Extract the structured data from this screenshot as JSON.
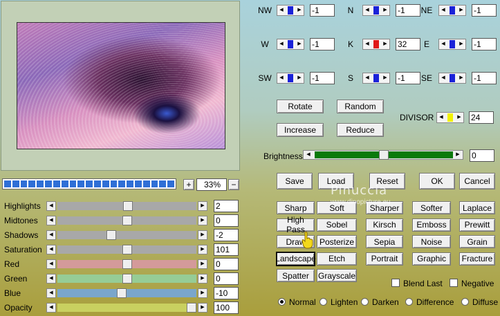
{
  "zoom": {
    "plus": "+",
    "value": "33%",
    "minus": "−"
  },
  "progress_segments": 21,
  "grid": [
    {
      "dir": "NW",
      "value": "-1",
      "color": "#1a22d8"
    },
    {
      "dir": "N",
      "value": "-1",
      "color": "#1a22d8"
    },
    {
      "dir": "NE",
      "value": "-1",
      "color": "#1a22d8"
    },
    {
      "dir": "W",
      "value": "-1",
      "color": "#1a22d8"
    },
    {
      "dir": "K",
      "value": "32",
      "color": "#e01818"
    },
    {
      "dir": "E",
      "value": "-1",
      "color": "#1a22d8"
    },
    {
      "dir": "SW",
      "value": "-1",
      "color": "#1a22d8"
    },
    {
      "dir": "S",
      "value": "-1",
      "color": "#1a22d8"
    },
    {
      "dir": "SE",
      "value": "-1",
      "color": "#1a22d8"
    }
  ],
  "action_buttons": {
    "rotate": "Rotate",
    "random": "Random",
    "increase": "Increase",
    "reduce": "Reduce"
  },
  "divisor": {
    "label": "DIVISOR",
    "value": "24",
    "color": "#f2f200"
  },
  "brightness": {
    "label": "Brightness",
    "value": "0",
    "level": 0.5,
    "color": "#0a7a0a"
  },
  "main_buttons": {
    "save": "Save",
    "load": "Load",
    "reset": "Reset",
    "ok": "OK",
    "cancel": "Cancel"
  },
  "watermark": {
    "title": "Pinuccia",
    "site": "www.dinopicture.eu"
  },
  "filters": [
    [
      "Sharp",
      "Soft",
      "Sharper",
      "Softer",
      "Laplace"
    ],
    [
      "High Pass",
      "Sobel",
      "Kirsch",
      "Emboss",
      "Prewitt"
    ],
    [
      "Draw",
      "Posterize",
      "Sepia",
      "Noise",
      "Grain"
    ],
    [
      "Landscape",
      "Etch",
      "Portrait",
      "Graphic",
      "Fracture"
    ],
    [
      "Spatter",
      "Grayscale"
    ]
  ],
  "selected_filter": "Landscape",
  "checkboxes": {
    "blend_last": "Blend Last",
    "negative": "Negative"
  },
  "blend_modes": [
    "Normal",
    "Lighten",
    "Darken",
    "Difference",
    "Diffuse"
  ],
  "selected_blend": "Normal",
  "adjustments": [
    {
      "label": "Highlights",
      "value": "2",
      "level": 0.51,
      "color": "#a8a8a8"
    },
    {
      "label": "Midtones",
      "value": "0",
      "level": 0.5,
      "color": "#a8a8a8"
    },
    {
      "label": "Shadows",
      "value": "-2",
      "level": 0.38,
      "color": "#a8a8a8"
    },
    {
      "label": "Saturation",
      "value": "101",
      "level": 0.5,
      "color": "#a8a8a8"
    },
    {
      "label": "Red",
      "value": "0",
      "level": 0.5,
      "color": "#d49a9a"
    },
    {
      "label": "Green",
      "value": "0",
      "level": 0.5,
      "color": "#96cc96"
    },
    {
      "label": "Blue",
      "value": "-10",
      "level": 0.46,
      "color": "#7aa6cc"
    },
    {
      "label": "Opacity",
      "value": "100",
      "level": 1.0,
      "color": "#c9d060"
    }
  ]
}
